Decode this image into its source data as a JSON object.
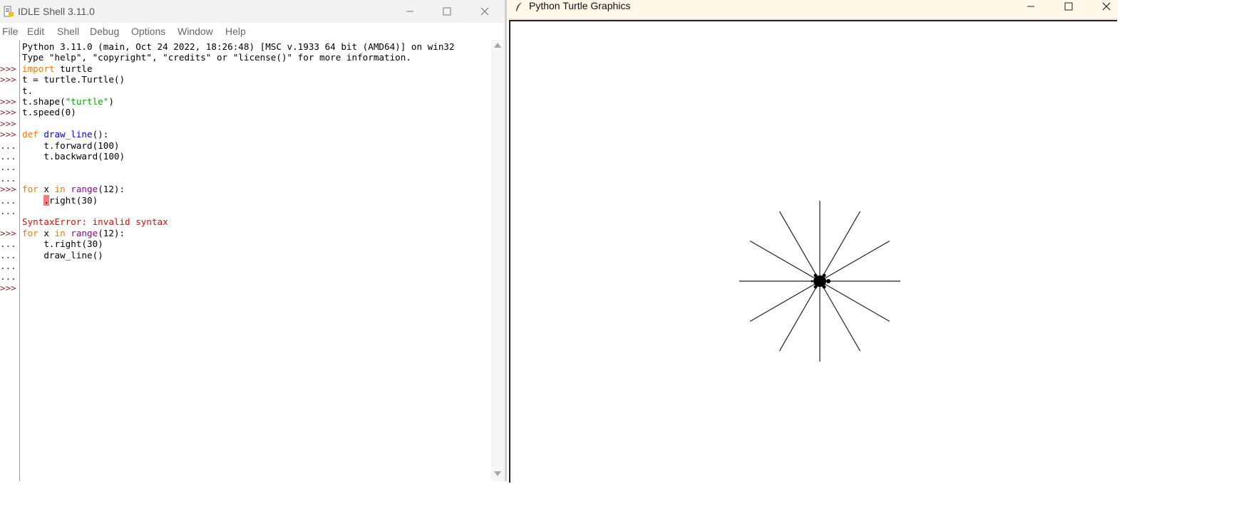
{
  "idle": {
    "title": "IDLE Shell 3.11.0",
    "menu": [
      "File",
      "Edit",
      "Shell",
      "Debug",
      "Options",
      "Window",
      "Help"
    ],
    "gutter": [
      ">>>",
      ">>>",
      "",
      ">>>",
      ">>>",
      ">>>",
      ">>>",
      "...",
      "...",
      "...",
      "...",
      ">>>",
      "...",
      "...",
      "",
      ">>>",
      "...",
      "...",
      "...",
      "...",
      ">>>"
    ],
    "lines": [
      "Python 3.11.0 (main, Oct 24 2022, 18:26:48) [MSC v.1933 64 bit (AMD64)] on win32",
      "Type \"help\", \"copyright\", \"credits\" or \"license()\" for more information.",
      "import turtle",
      "t = turtle.Turtle()",
      "t.",
      "t.shape(\"turtle\")",
      "t.speed(0)",
      "",
      "def draw_line():",
      "    t.forward(100)",
      "    t.backward(100)",
      "",
      "",
      "for x in range(12):",
      "    .right(30)",
      "",
      "SyntaxError: invalid syntax",
      "for x in range(12):",
      "    t.right(30)",
      "    draw_line()",
      "",
      "",
      ""
    ]
  },
  "turtle": {
    "title": "Python Turtle Graphics",
    "lines": 12,
    "angle_step": 30,
    "length": 100
  },
  "colors": {
    "keyword": "#ff7700",
    "builtin": "#900090",
    "definition": "#0000ff",
    "string": "#00aa00",
    "error": "#ff0000"
  }
}
